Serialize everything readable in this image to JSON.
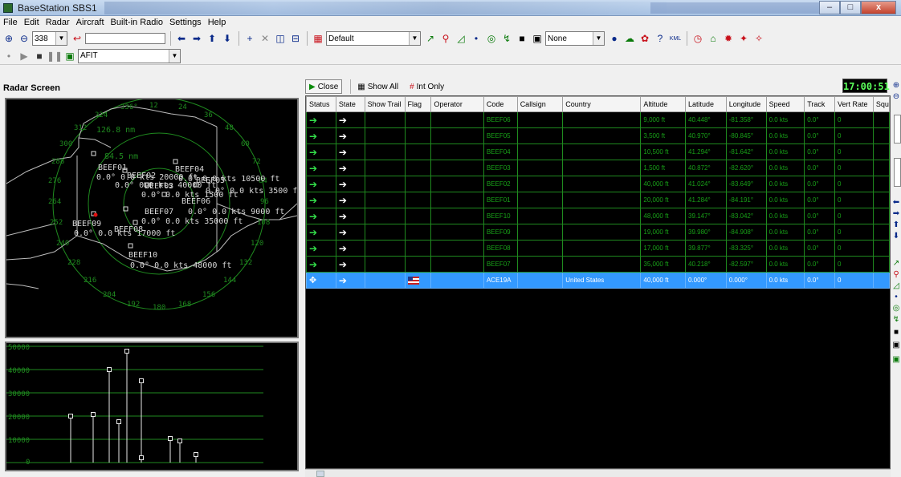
{
  "window": {
    "title": "BaseStation SBS1",
    "controls": [
      "–",
      "□",
      "x"
    ]
  },
  "menu": [
    "File",
    "Edit",
    "Radar",
    "Aircraft",
    "Built-in Radio",
    "Settings",
    "Help"
  ],
  "toolbar": {
    "zoom_value": "338",
    "profile_value": "Default",
    "overlay_value": "None",
    "filter_value": "AFIT"
  },
  "left": {
    "radar_title": "Radar Screen",
    "range_rings": [
      "126.8 nm",
      "84.5 nm"
    ],
    "compass_labels": [
      "336°",
      "324",
      "312",
      "300",
      "288",
      "276",
      "264",
      "252",
      "240",
      "228",
      "216",
      "204",
      "192",
      "180",
      "168",
      "156",
      "144",
      "132",
      "120",
      "108",
      "96",
      "84",
      "72",
      "60",
      "48",
      "36",
      "24",
      "12"
    ],
    "aircraft_labels": [
      {
        "code": "BEEF01",
        "info": "0.0° 0.0 kts 20000 ft"
      },
      {
        "code": "BEEF02",
        "info": "0.0° 0.0 kts 40000 ft"
      },
      {
        "code": "BEEF03",
        "info": "0.0° 0.0 kts 1500 ft"
      },
      {
        "code": "BEEF04",
        "info": "0.0° 0.0 kts 10500 ft"
      },
      {
        "code": "BEEF05",
        "info": "0.0° 0.0 kts 3500 ft"
      },
      {
        "code": "BEEF06",
        "info": ""
      },
      {
        "code": "BEEF07",
        "info": "0.0° 0.0 kts 9000 ft"
      },
      {
        "code": "BEEF08",
        "info": "0.0° 0.0 kts 35000 ft"
      },
      {
        "code": "BEEF09",
        "info": "0.0° 0.0 kts 17000 ft"
      },
      {
        "code": "BEEF10",
        "info": "0.0° 0.0 kts 48000 ft"
      }
    ],
    "altitude_axis": [
      "50000",
      "40000",
      "30000",
      "20000",
      "10000",
      "0"
    ]
  },
  "right": {
    "close_label": "Close",
    "show_all_label": "Show All",
    "int_only_label": "Int Only",
    "clock": "17:00:51",
    "columns": [
      "Status",
      "State",
      "Show Trail",
      "Flag",
      "Operator",
      "Code",
      "Callsign",
      "Country",
      "Altitude",
      "Latitude",
      "Longitude",
      "Speed",
      "Track",
      "Vert Rate",
      "Squ"
    ],
    "rows": [
      {
        "code": "BEEF06",
        "country": "",
        "altitude": "9,000 ft",
        "lat": "40.448°",
        "lon": "-81.358°",
        "speed": "0.0 kts",
        "track": "0.0°",
        "vrate": "0",
        "selected": false
      },
      {
        "code": "BEEF05",
        "country": "",
        "altitude": "3,500 ft",
        "lat": "40.970°",
        "lon": "-80.845°",
        "speed": "0.0 kts",
        "track": "0.0°",
        "vrate": "0",
        "selected": false
      },
      {
        "code": "BEEF04",
        "country": "",
        "altitude": "10,500 ft",
        "lat": "41.294°",
        "lon": "-81.642°",
        "speed": "0.0 kts",
        "track": "0.0°",
        "vrate": "0",
        "selected": false
      },
      {
        "code": "BEEF03",
        "country": "",
        "altitude": "1,500 ft",
        "lat": "40.872°",
        "lon": "-82.620°",
        "speed": "0.0 kts",
        "track": "0.0°",
        "vrate": "0",
        "selected": false
      },
      {
        "code": "BEEF02",
        "country": "",
        "altitude": "40,000 ft",
        "lat": "41.024°",
        "lon": "-83.649°",
        "speed": "0.0 kts",
        "track": "0.0°",
        "vrate": "0",
        "selected": false
      },
      {
        "code": "BEEF01",
        "country": "",
        "altitude": "20,000 ft",
        "lat": "41.284°",
        "lon": "-84.191°",
        "speed": "0.0 kts",
        "track": "0.0°",
        "vrate": "0",
        "selected": false
      },
      {
        "code": "BEEF10",
        "country": "",
        "altitude": "48,000 ft",
        "lat": "39.147°",
        "lon": "-83.042°",
        "speed": "0.0 kts",
        "track": "0.0°",
        "vrate": "0",
        "selected": false
      },
      {
        "code": "BEEF09",
        "country": "",
        "altitude": "19,000 ft",
        "lat": "39.980°",
        "lon": "-84.908°",
        "speed": "0.0 kts",
        "track": "0.0°",
        "vrate": "0",
        "selected": false
      },
      {
        "code": "BEEF08",
        "country": "",
        "altitude": "17,000 ft",
        "lat": "39.877°",
        "lon": "-83.325°",
        "speed": "0.0 kts",
        "track": "0.0°",
        "vrate": "0",
        "selected": false
      },
      {
        "code": "BEEF07",
        "country": "",
        "altitude": "35,000 ft",
        "lat": "40.218°",
        "lon": "-82.597°",
        "speed": "0.0 kts",
        "track": "0.0°",
        "vrate": "0",
        "selected": false
      },
      {
        "code": "ACE19A",
        "country": "United States",
        "altitude": "40,000 ft",
        "lat": "0.000°",
        "lon": "0.000°",
        "speed": "0.0 kts",
        "track": "0.0°",
        "vrate": "0",
        "selected": true
      }
    ]
  },
  "colors": {
    "grid_green": "#18a018",
    "arrow_green": "#33e04a",
    "selected_row": "#3399ff",
    "radar_green": "#1f8a1f",
    "clock_green": "#5aff5a"
  }
}
